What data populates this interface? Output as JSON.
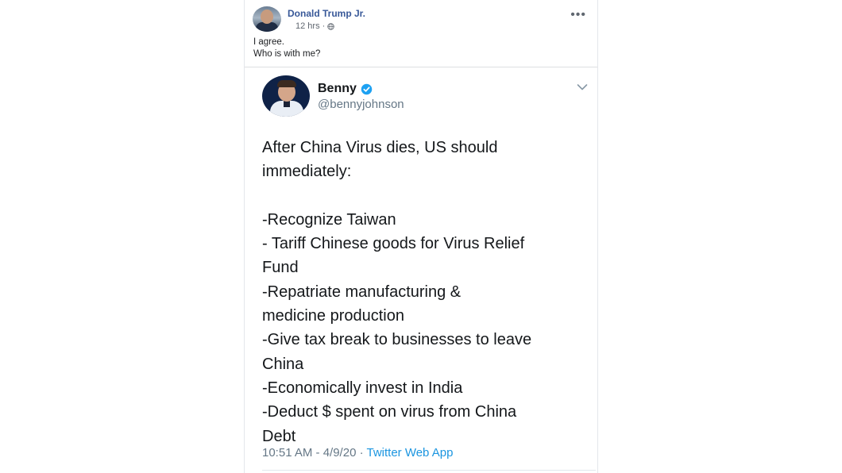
{
  "post": {
    "author": "Donald Trump Jr.",
    "time": "12 hrs",
    "separator": "·",
    "more": "•••",
    "text_line1": "I agree.",
    "text_line2": "Who is with me?",
    "privacy_icon": "globe-icon"
  },
  "tweet": {
    "name": "Benny",
    "handle": "@bennyjohnson",
    "verified_icon": "verified-badge-icon",
    "body": "After China Virus dies, US should\nimmediately:\n\n -Recognize Taiwan\n- Tariff Chinese goods for Virus Relief\nFund\n -Repatriate manufacturing &\nmedicine production\n -Give tax break to businesses to leave\nChina\n -Economically invest in India\n -Deduct $ spent on virus from China\nDebt",
    "timestamp": "10:51 AM - 4/9/20",
    "dot": " · ",
    "source": "Twitter Web App"
  },
  "colors": {
    "fb_link": "#385898",
    "twitter_blue": "#1b95e0",
    "muted": "#657786"
  }
}
